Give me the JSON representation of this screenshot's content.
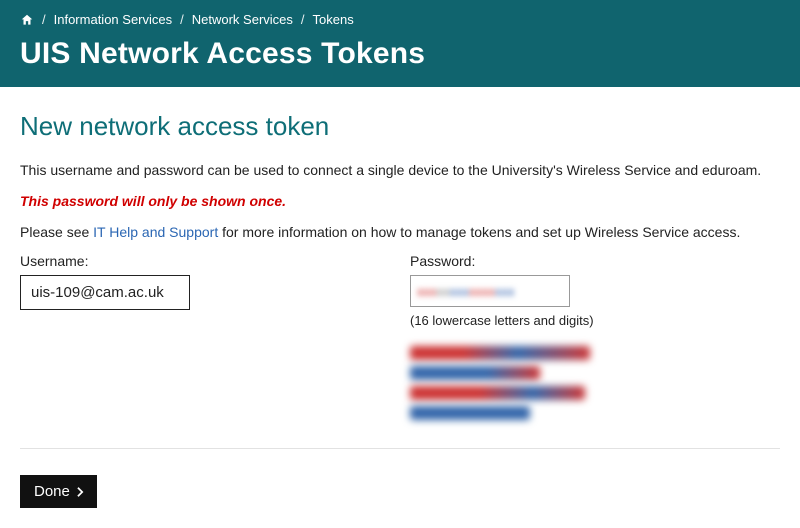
{
  "breadcrumb": {
    "items": [
      "Information Services",
      "Network Services",
      "Tokens"
    ]
  },
  "page_title": "UIS Network Access Tokens",
  "subhead": "New network access token",
  "intro": "This username and password can be used to connect a single device to the University's Wireless Service and eduroam.",
  "warning": "This password will only be shown once.",
  "help_prefix": "Please see ",
  "help_link_text": "IT Help and Support",
  "help_suffix": " for more information on how to manage tokens and set up Wireless Service access.",
  "username_label": "Username:",
  "username_value": "uis-109@cam.ac.uk",
  "password_label": "Password:",
  "password_hint": "(16 lowercase letters and digits)",
  "done_label": "Done"
}
